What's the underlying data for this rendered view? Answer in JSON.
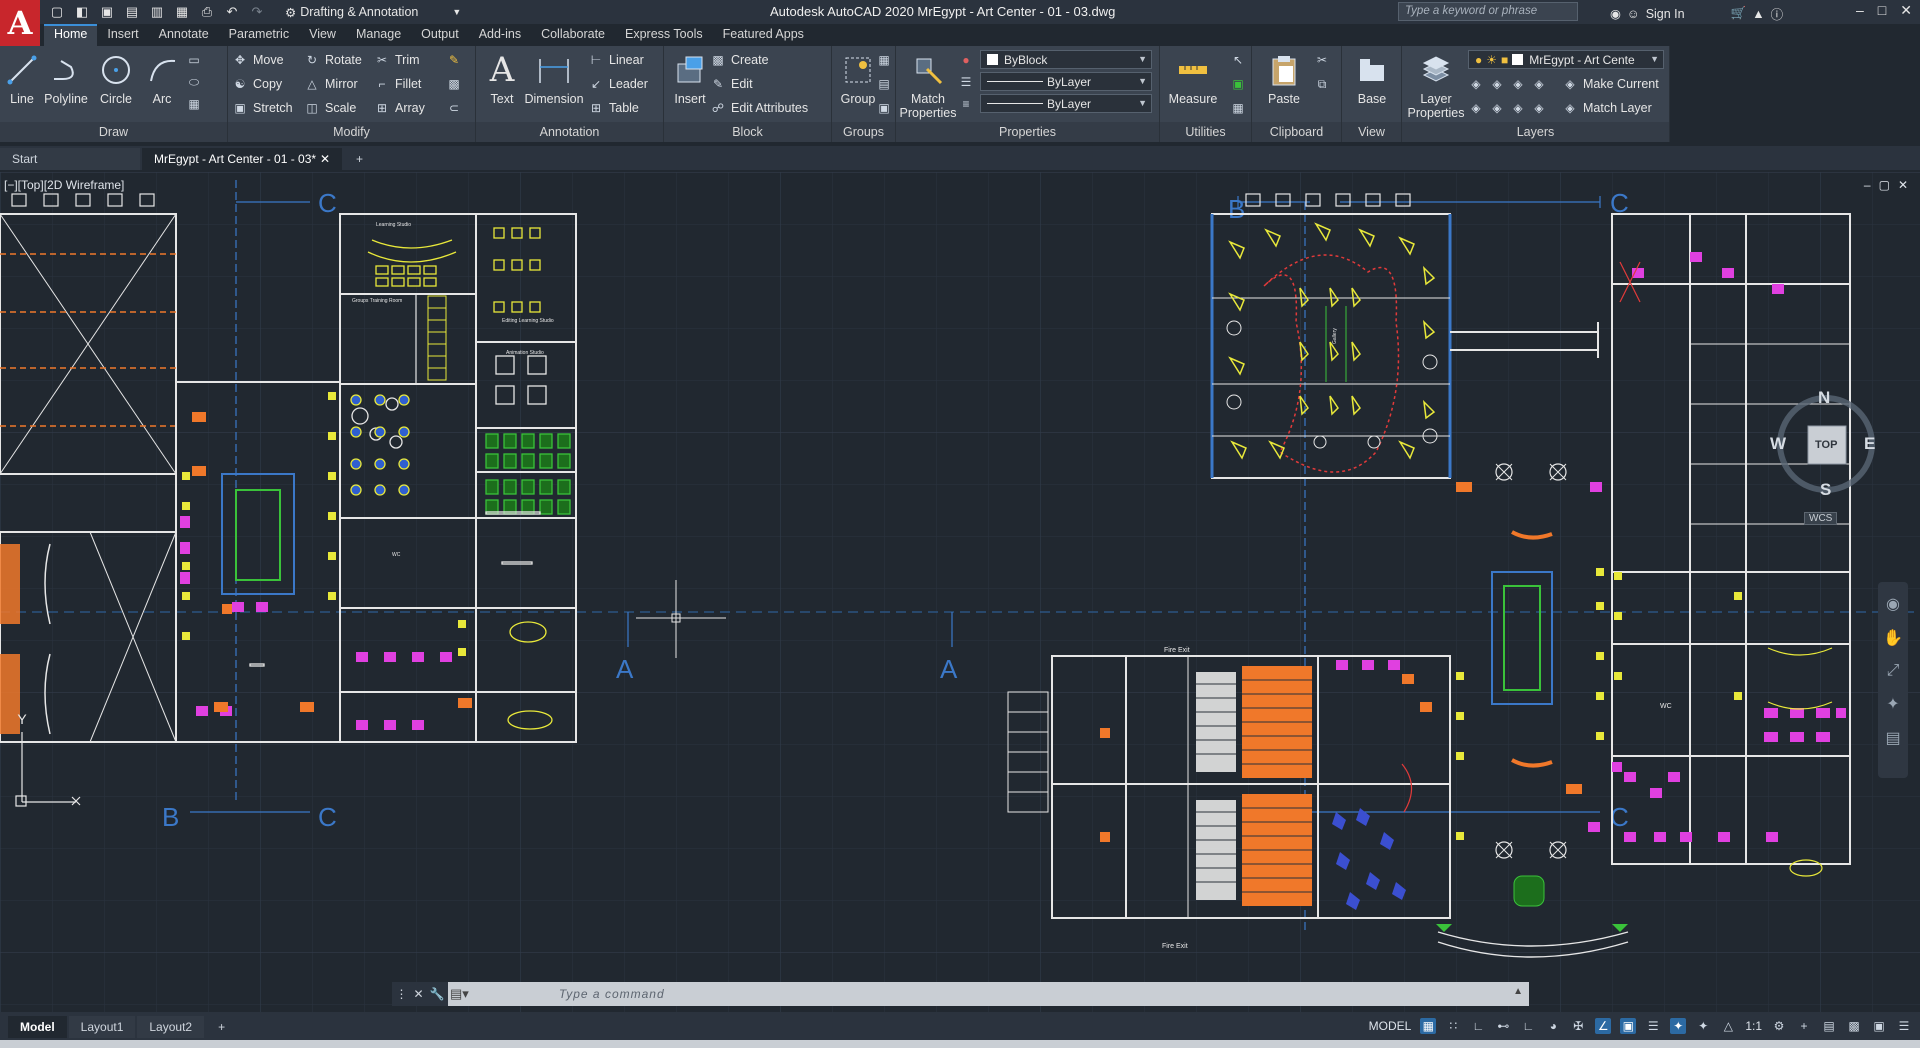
{
  "app": {
    "logo_letter": "A",
    "workspace": "Drafting & Annotation",
    "window_title": "Autodesk AutoCAD 2020   MrEgypt - Art Center - 01 - 03.dwg",
    "search_placeholder": "Type a keyword or phrase",
    "sign_in": "Sign In"
  },
  "ribbon_tabs": [
    "Home",
    "Insert",
    "Annotate",
    "Parametric",
    "View",
    "Manage",
    "Output",
    "Add-ins",
    "Collaborate",
    "Express Tools",
    "Featured Apps"
  ],
  "ribbon": {
    "draw": {
      "title": "Draw",
      "line": "Line",
      "polyline": "Polyline",
      "circle": "Circle",
      "arc": "Arc"
    },
    "modify": {
      "title": "Modify",
      "move": "Move",
      "rotate": "Rotate",
      "trim": "Trim",
      "copy": "Copy",
      "mirror": "Mirror",
      "fillet": "Fillet",
      "stretch": "Stretch",
      "scale": "Scale",
      "array": "Array"
    },
    "annotation": {
      "title": "Annotation",
      "text": "Text",
      "dimension": "Dimension",
      "linear": "Linear",
      "leader": "Leader",
      "table": "Table"
    },
    "block": {
      "title": "Block",
      "insert": "Insert",
      "create": "Create",
      "edit": "Edit",
      "edit_attributes": "Edit Attributes"
    },
    "groups": {
      "title": "Groups",
      "group": "Group"
    },
    "properties": {
      "title": "Properties",
      "match": "Match Properties",
      "color": "ByBlock",
      "linetype": "ByLayer",
      "lineweight": "ByLayer"
    },
    "utilities": {
      "title": "Utilities",
      "measure": "Measure"
    },
    "clipboard": {
      "title": "Clipboard",
      "paste": "Paste"
    },
    "view": {
      "title": "View",
      "base": "Base"
    },
    "layers": {
      "title": "Layers",
      "layer_properties": "Layer Properties",
      "current_layer": "MrEgypt - Art Cente",
      "make_current": "Make Current",
      "match_layer": "Match Layer"
    }
  },
  "file_tabs": {
    "start": "Start",
    "active": "MrEgypt - Art Center - 01 - 03*"
  },
  "viewport": {
    "label": "[−][Top][2D Wireframe]",
    "controls": [
      "–",
      "▢",
      "✕"
    ],
    "compass": {
      "n": "N",
      "e": "E",
      "s": "S",
      "w": "W",
      "top": "TOP",
      "wcs": "WCS"
    }
  },
  "drawing_labels": {
    "section_b": "B",
    "section_c": "C",
    "section_a": "A",
    "fire_exit": "Fire Exit",
    "wc": "WC",
    "axis_y": "Y",
    "learning_studio": "Learning Studio",
    "group_training_room": "Groups Training Room",
    "editing_learning_studio": "Editing Learning Studio",
    "animation_studio": "Animation Studio",
    "gallery": "Gallery"
  },
  "command_line": {
    "placeholder": "Type  a  command"
  },
  "layout_tabs": [
    "Model",
    "Layout1",
    "Layout2"
  ],
  "status": {
    "model": "MODEL",
    "scale": "1:1"
  },
  "colors": {
    "background": "#212830",
    "grid": "#2b3440",
    "walls": "#e6e6e6",
    "furniture_yellow": "#e8e83a",
    "furniture_green": "#3ac23a",
    "magenta": "#e040e0",
    "orange": "#f0782a",
    "section_blue": "#3b78c8",
    "red_dashed": "#e23a3a"
  }
}
